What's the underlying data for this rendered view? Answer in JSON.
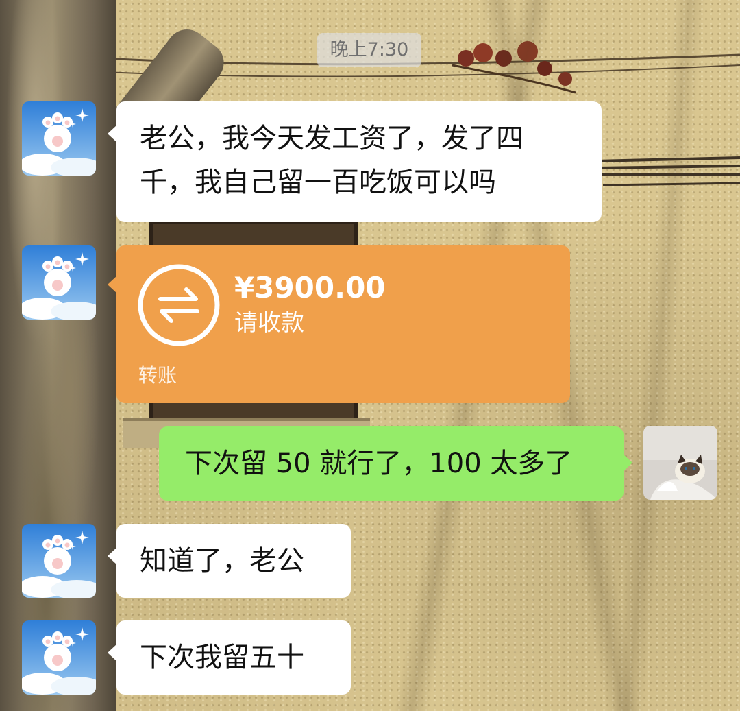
{
  "chat": {
    "timestamp": "晚上7:30",
    "messages": [
      {
        "sender": "other",
        "type": "text",
        "lines": [
          "老公，我今天发工资了，发了四",
          "千，我自己留一百吃饭可以吗"
        ]
      },
      {
        "sender": "other",
        "type": "transfer",
        "amount": "¥3900.00",
        "status": "请收款",
        "label": "转账"
      },
      {
        "sender": "self",
        "type": "text",
        "text": "下次留 50 就行了，100 太多了"
      },
      {
        "sender": "other",
        "type": "text",
        "text": "知道了，老公"
      },
      {
        "sender": "other",
        "type": "text",
        "text": "下次我留五十"
      }
    ]
  },
  "icons": {
    "transfer": "transfer-arrows-icon",
    "other_avatar": "cat-paw-cloud-avatar",
    "self_avatar": "cat-photo-avatar"
  },
  "colors": {
    "bubble_incoming": "#ffffff",
    "bubble_outgoing": "#95ec69",
    "transfer_card": "#f0a04b",
    "timestamp_bg": "#dedede"
  }
}
